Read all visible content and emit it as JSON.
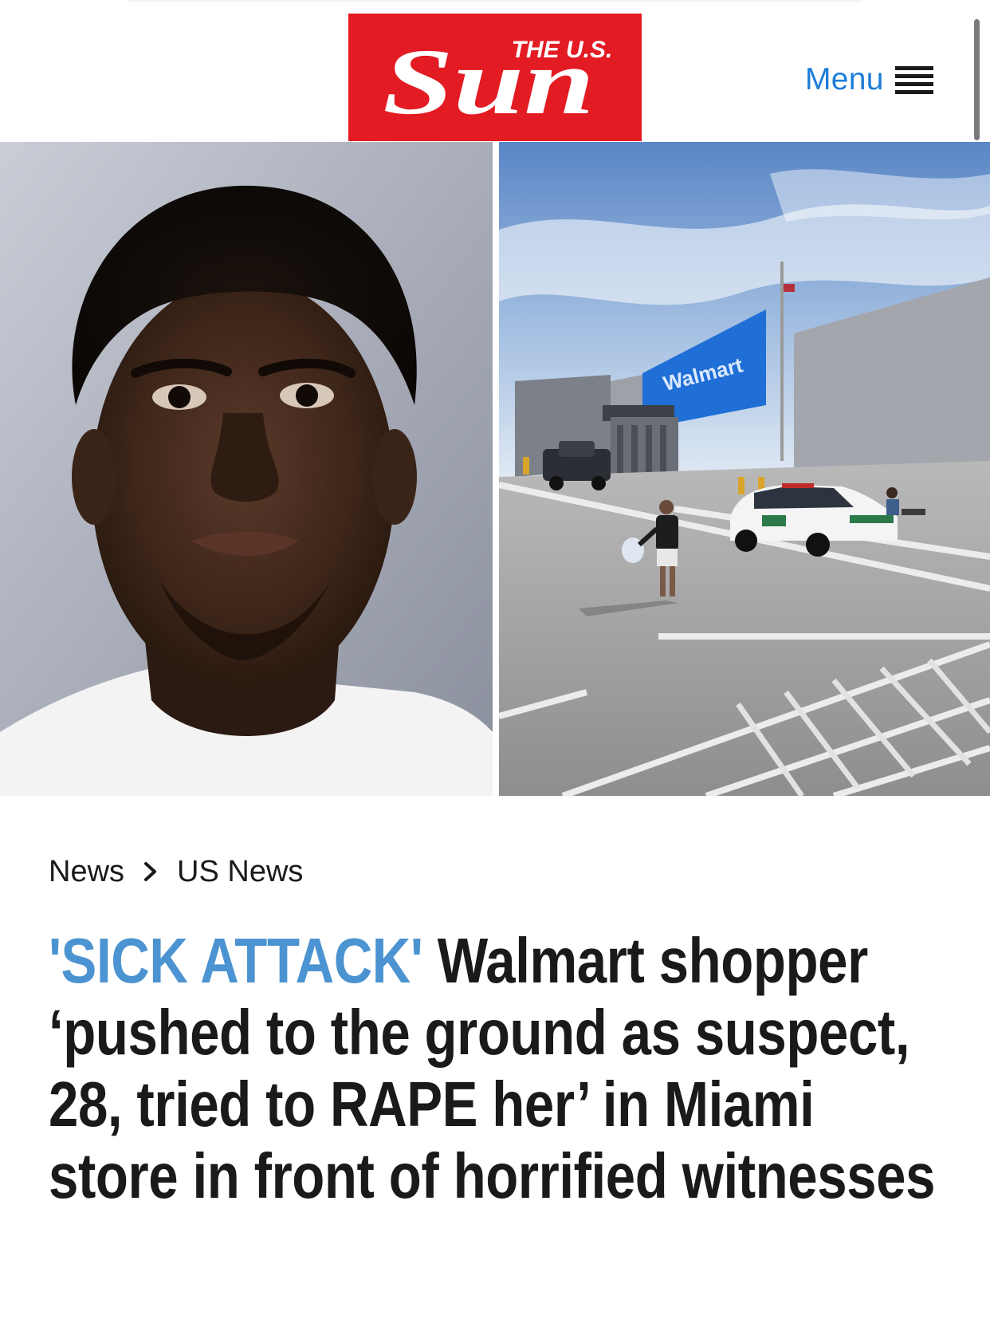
{
  "header": {
    "logo": {
      "prefix": "THE U.S.",
      "wordmark": "Sun",
      "brand_color": "#e31b23"
    },
    "menu": {
      "label": "Menu",
      "icon": "hamburger-icon",
      "label_color": "#1e7dd8"
    }
  },
  "hero": {
    "photos": [
      {
        "subject": "suspect mugshot"
      },
      {
        "subject": "Walmart store parking lot with police car",
        "sign": "Walmart"
      }
    ]
  },
  "breadcrumb": {
    "items": [
      "News",
      "US News"
    ],
    "separator_icon": "chevron-right-icon"
  },
  "article": {
    "kicker": "'SICK ATTACK'",
    "kicker_color": "#4b93d1",
    "headline": "Walmart shopper ‘pushed to the ground as suspect, 28, tried to RAPE her’ in Miami store in front of horrified witnesses"
  }
}
